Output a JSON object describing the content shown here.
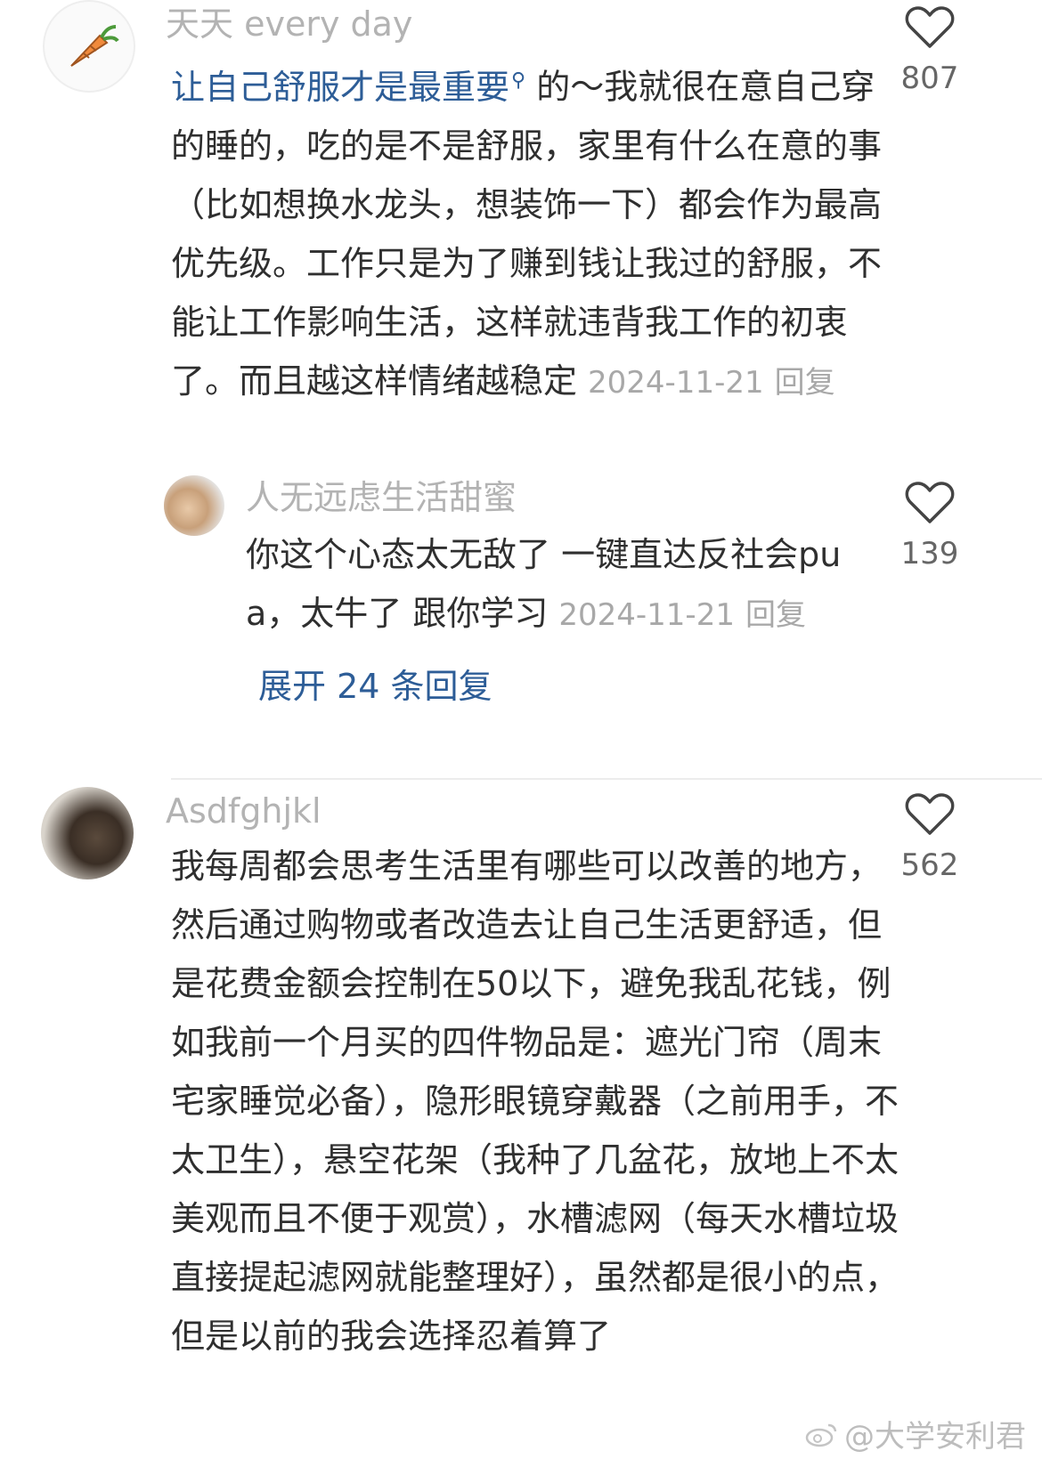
{
  "comments": [
    {
      "username": "天天 every day",
      "link_text": "让自己舒服才是最重要",
      "text": "的～我就很在意自己穿的睡的，吃的是不是舒服，家里有什么在意的事（比如想换水龙头，想装饰一下）都会作为最高优先级。工作只是为了赚到钱让我过的舒服，不能让工作影响生活，这样就违背我工作的初衷了。而且越这样情绪越稳定",
      "date": "2024-11-21",
      "reply_label": "回复",
      "likes": "807",
      "avatar_icon": "carrot-icon"
    },
    {
      "username": "Asdfghjkl",
      "text": "我每周都会思考生活里有哪些可以改善的地方，然后通过购物或者改造去让自己生活更舒适，但是花费金额会控制在50以下，避免我乱花钱，例如我前一个月买的四件物品是：遮光门帘（周末宅家睡觉必备），隐形眼镜穿戴器（之前用手，不太卫生），悬空花架（我种了几盆花，放地上不太美观而且不便于观赏），水槽滤网（每天水槽垃圾直接提起滤网就能整理好），虽然都是很小的点，但是以前的我会选择忍着算了",
      "likes": "562"
    }
  ],
  "reply": {
    "username": "人无远虑生活甜蜜",
    "text": "你这个心态太无敌了 一键直达反社会pua，太牛了 跟你学习",
    "date": "2024-11-21",
    "reply_label": "回复",
    "likes": "139"
  },
  "expand_label": "展开 24 条回复",
  "watermark": "@大学安利君",
  "colors": {
    "link": "#2d5d97",
    "muted": "#b3b3b3"
  }
}
